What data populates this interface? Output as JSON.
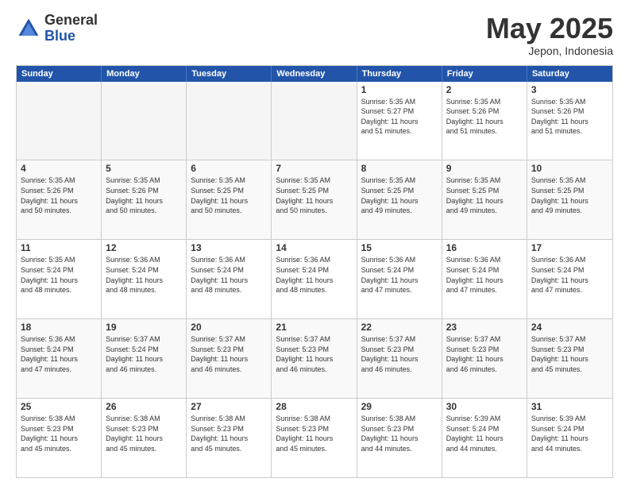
{
  "header": {
    "logo": {
      "general": "General",
      "blue": "Blue"
    },
    "month": "May 2025",
    "location": "Jepon, Indonesia"
  },
  "weekdays": [
    "Sunday",
    "Monday",
    "Tuesday",
    "Wednesday",
    "Thursday",
    "Friday",
    "Saturday"
  ],
  "rows": [
    [
      {
        "day": "",
        "info": "",
        "empty": true
      },
      {
        "day": "",
        "info": "",
        "empty": true
      },
      {
        "day": "",
        "info": "",
        "empty": true
      },
      {
        "day": "",
        "info": "",
        "empty": true
      },
      {
        "day": "1",
        "info": "Sunrise: 5:35 AM\nSunset: 5:27 PM\nDaylight: 11 hours\nand 51 minutes."
      },
      {
        "day": "2",
        "info": "Sunrise: 5:35 AM\nSunset: 5:26 PM\nDaylight: 11 hours\nand 51 minutes."
      },
      {
        "day": "3",
        "info": "Sunrise: 5:35 AM\nSunset: 5:26 PM\nDaylight: 11 hours\nand 51 minutes."
      }
    ],
    [
      {
        "day": "4",
        "info": "Sunrise: 5:35 AM\nSunset: 5:26 PM\nDaylight: 11 hours\nand 50 minutes."
      },
      {
        "day": "5",
        "info": "Sunrise: 5:35 AM\nSunset: 5:26 PM\nDaylight: 11 hours\nand 50 minutes."
      },
      {
        "day": "6",
        "info": "Sunrise: 5:35 AM\nSunset: 5:25 PM\nDaylight: 11 hours\nand 50 minutes."
      },
      {
        "day": "7",
        "info": "Sunrise: 5:35 AM\nSunset: 5:25 PM\nDaylight: 11 hours\nand 50 minutes."
      },
      {
        "day": "8",
        "info": "Sunrise: 5:35 AM\nSunset: 5:25 PM\nDaylight: 11 hours\nand 49 minutes."
      },
      {
        "day": "9",
        "info": "Sunrise: 5:35 AM\nSunset: 5:25 PM\nDaylight: 11 hours\nand 49 minutes."
      },
      {
        "day": "10",
        "info": "Sunrise: 5:35 AM\nSunset: 5:25 PM\nDaylight: 11 hours\nand 49 minutes."
      }
    ],
    [
      {
        "day": "11",
        "info": "Sunrise: 5:35 AM\nSunset: 5:24 PM\nDaylight: 11 hours\nand 48 minutes."
      },
      {
        "day": "12",
        "info": "Sunrise: 5:36 AM\nSunset: 5:24 PM\nDaylight: 11 hours\nand 48 minutes."
      },
      {
        "day": "13",
        "info": "Sunrise: 5:36 AM\nSunset: 5:24 PM\nDaylight: 11 hours\nand 48 minutes."
      },
      {
        "day": "14",
        "info": "Sunrise: 5:36 AM\nSunset: 5:24 PM\nDaylight: 11 hours\nand 48 minutes."
      },
      {
        "day": "15",
        "info": "Sunrise: 5:36 AM\nSunset: 5:24 PM\nDaylight: 11 hours\nand 47 minutes."
      },
      {
        "day": "16",
        "info": "Sunrise: 5:36 AM\nSunset: 5:24 PM\nDaylight: 11 hours\nand 47 minutes."
      },
      {
        "day": "17",
        "info": "Sunrise: 5:36 AM\nSunset: 5:24 PM\nDaylight: 11 hours\nand 47 minutes."
      }
    ],
    [
      {
        "day": "18",
        "info": "Sunrise: 5:36 AM\nSunset: 5:24 PM\nDaylight: 11 hours\nand 47 minutes."
      },
      {
        "day": "19",
        "info": "Sunrise: 5:37 AM\nSunset: 5:24 PM\nDaylight: 11 hours\nand 46 minutes."
      },
      {
        "day": "20",
        "info": "Sunrise: 5:37 AM\nSunset: 5:23 PM\nDaylight: 11 hours\nand 46 minutes."
      },
      {
        "day": "21",
        "info": "Sunrise: 5:37 AM\nSunset: 5:23 PM\nDaylight: 11 hours\nand 46 minutes."
      },
      {
        "day": "22",
        "info": "Sunrise: 5:37 AM\nSunset: 5:23 PM\nDaylight: 11 hours\nand 46 minutes."
      },
      {
        "day": "23",
        "info": "Sunrise: 5:37 AM\nSunset: 5:23 PM\nDaylight: 11 hours\nand 46 minutes."
      },
      {
        "day": "24",
        "info": "Sunrise: 5:37 AM\nSunset: 5:23 PM\nDaylight: 11 hours\nand 45 minutes."
      }
    ],
    [
      {
        "day": "25",
        "info": "Sunrise: 5:38 AM\nSunset: 5:23 PM\nDaylight: 11 hours\nand 45 minutes."
      },
      {
        "day": "26",
        "info": "Sunrise: 5:38 AM\nSunset: 5:23 PM\nDaylight: 11 hours\nand 45 minutes."
      },
      {
        "day": "27",
        "info": "Sunrise: 5:38 AM\nSunset: 5:23 PM\nDaylight: 11 hours\nand 45 minutes."
      },
      {
        "day": "28",
        "info": "Sunrise: 5:38 AM\nSunset: 5:23 PM\nDaylight: 11 hours\nand 45 minutes."
      },
      {
        "day": "29",
        "info": "Sunrise: 5:38 AM\nSunset: 5:23 PM\nDaylight: 11 hours\nand 44 minutes."
      },
      {
        "day": "30",
        "info": "Sunrise: 5:39 AM\nSunset: 5:24 PM\nDaylight: 11 hours\nand 44 minutes."
      },
      {
        "day": "31",
        "info": "Sunrise: 5:39 AM\nSunset: 5:24 PM\nDaylight: 11 hours\nand 44 minutes."
      }
    ]
  ]
}
